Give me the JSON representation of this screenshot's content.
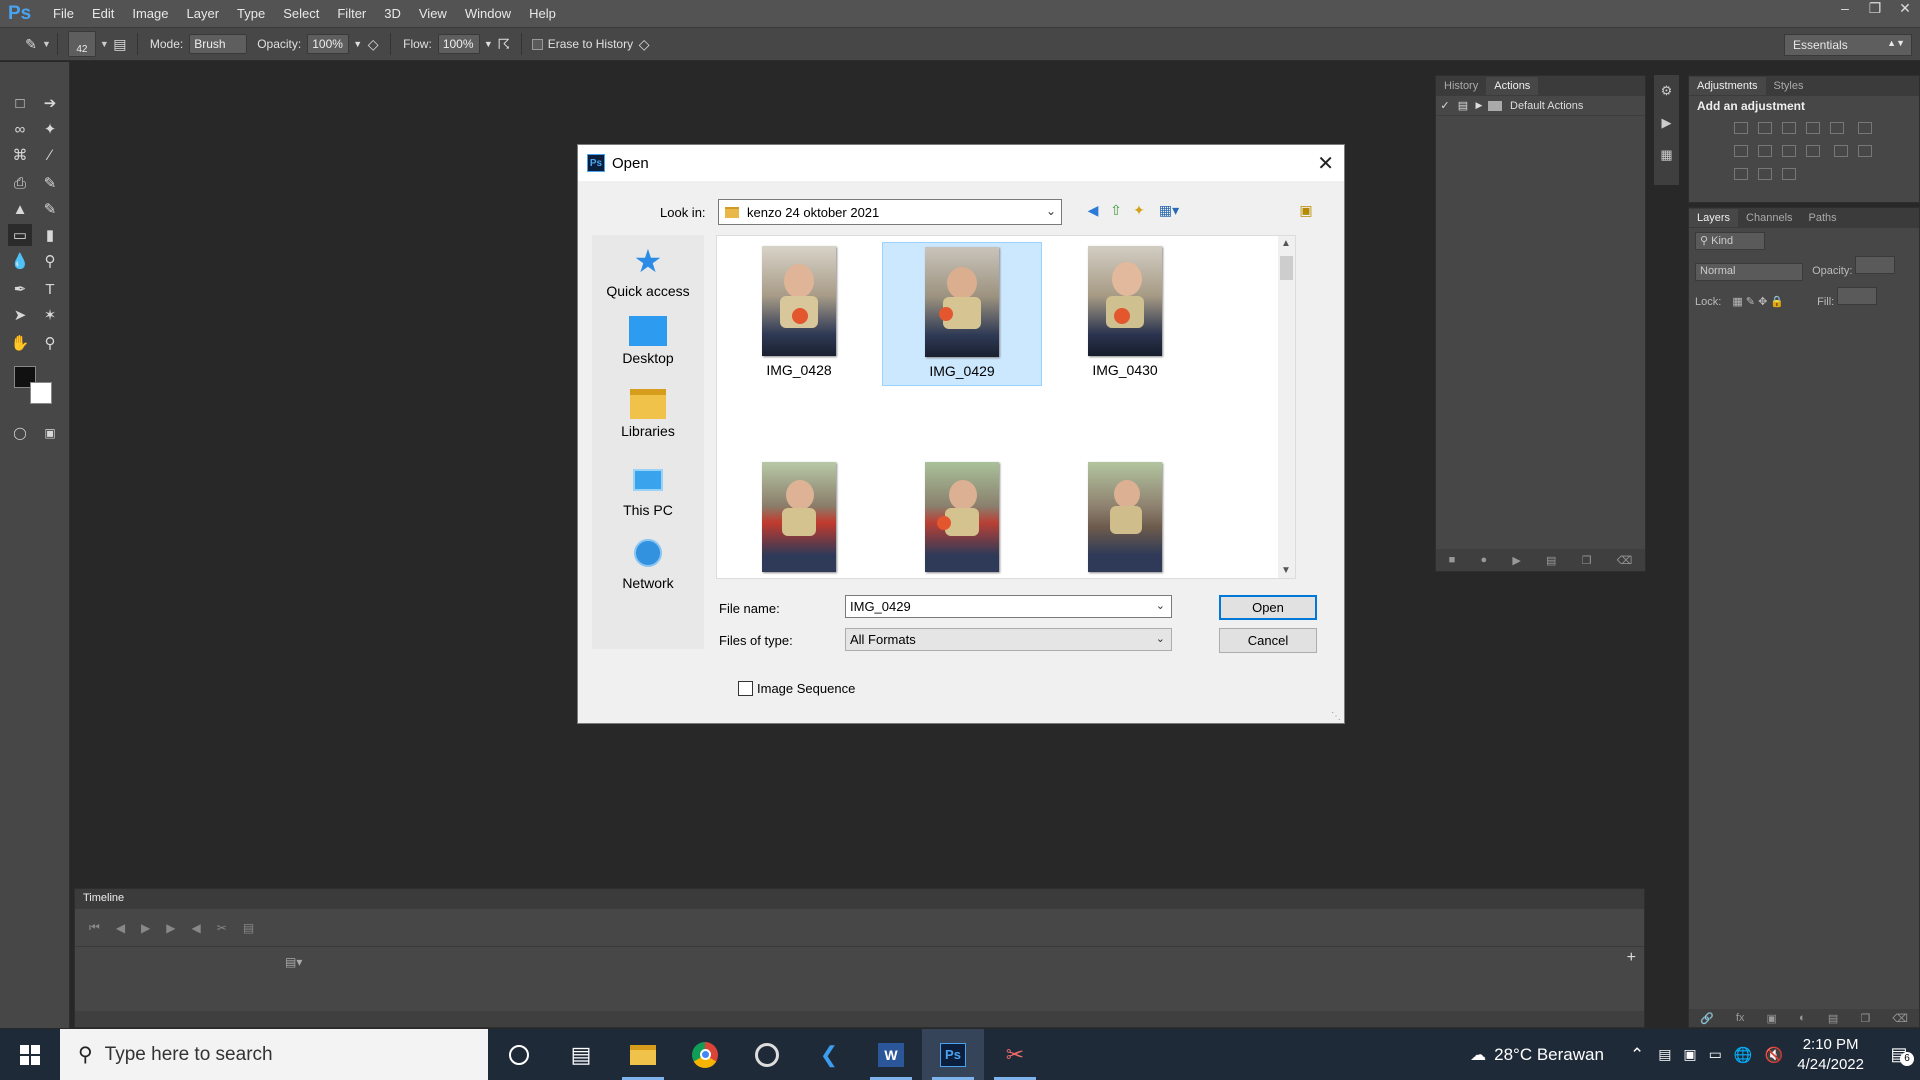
{
  "app": {
    "logo": "Ps",
    "menu": [
      "File",
      "Edit",
      "Image",
      "Layer",
      "Type",
      "Select",
      "Filter",
      "3D",
      "View",
      "Window",
      "Help"
    ]
  },
  "options_bar": {
    "brush_size": "42",
    "mode_label": "Mode:",
    "mode_value": "Brush",
    "opacity_label": "Opacity:",
    "opacity_value": "100%",
    "flow_label": "Flow:",
    "flow_value": "100%",
    "erase_to_history": "Erase to History",
    "workspace": "Essentials"
  },
  "panels": {
    "history_tab": "History",
    "actions_tab": "Actions",
    "default_actions": "Default Actions",
    "adjustments_tab": "Adjustments",
    "styles_tab": "Styles",
    "add_adjustment": "Add an adjustment",
    "layers_tab": "Layers",
    "channels_tab": "Channels",
    "paths_tab": "Paths",
    "kind_label": "Kind",
    "blend_mode": "Normal",
    "opacity_label": "Opacity:",
    "lock_label": "Lock:",
    "fill_label": "Fill:"
  },
  "timeline": {
    "title": "Timeline"
  },
  "dialog": {
    "title": "Open",
    "lookin_label": "Look in:",
    "lookin_value": "kenzo 24 oktober 2021",
    "places": [
      "Quick access",
      "Desktop",
      "Libraries",
      "This PC",
      "Network"
    ],
    "files": [
      {
        "name": "IMG_0428",
        "selected": false
      },
      {
        "name": "IMG_0429",
        "selected": true
      },
      {
        "name": "IMG_0430",
        "selected": false
      },
      {
        "name": "",
        "selected": false
      },
      {
        "name": "",
        "selected": false
      },
      {
        "name": "",
        "selected": false
      }
    ],
    "filename_label": "File name:",
    "filename_value": "IMG_0429",
    "filetype_label": "Files of type:",
    "filetype_value": "All Formats",
    "open_button": "Open",
    "cancel_button": "Cancel",
    "image_sequence": "Image Sequence"
  },
  "taskbar": {
    "search_placeholder": "Type here to search",
    "weather": "28°C  Berawan",
    "time": "2:10 PM",
    "date": "4/24/2022",
    "notification_count": "6"
  }
}
